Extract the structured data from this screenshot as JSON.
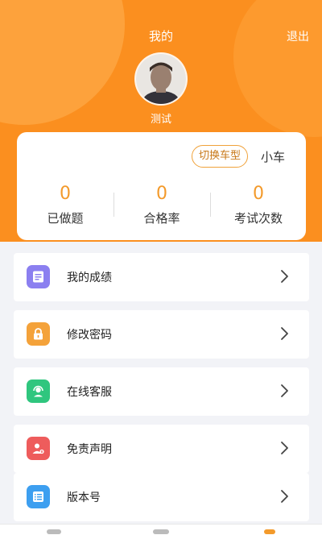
{
  "header": {
    "title": "我的",
    "logout_label": "退出",
    "username": "测试"
  },
  "stats": {
    "switch_label": "切换车型",
    "car_type": "小车",
    "items": [
      {
        "value": "0",
        "label": "已做题"
      },
      {
        "value": "0",
        "label": "合格率"
      },
      {
        "value": "0",
        "label": "考试次数"
      }
    ]
  },
  "menu": [
    {
      "label": "我的成绩",
      "icon": "report-icon",
      "color": "#8b7ff0"
    },
    {
      "label": "修改密码",
      "icon": "lock-icon",
      "color": "#f4a23a"
    },
    {
      "label": "在线客服",
      "icon": "customer-service-icon",
      "color": "#2fc67e"
    },
    {
      "label": "免责声明",
      "icon": "user-disclaimer-icon",
      "color": "#ee5c5c"
    },
    {
      "label": "版本号",
      "icon": "version-list-icon",
      "color": "#3d9ff0"
    }
  ],
  "colors": {
    "accent": "#fb8f1f",
    "stat_number": "#f39a2b"
  }
}
